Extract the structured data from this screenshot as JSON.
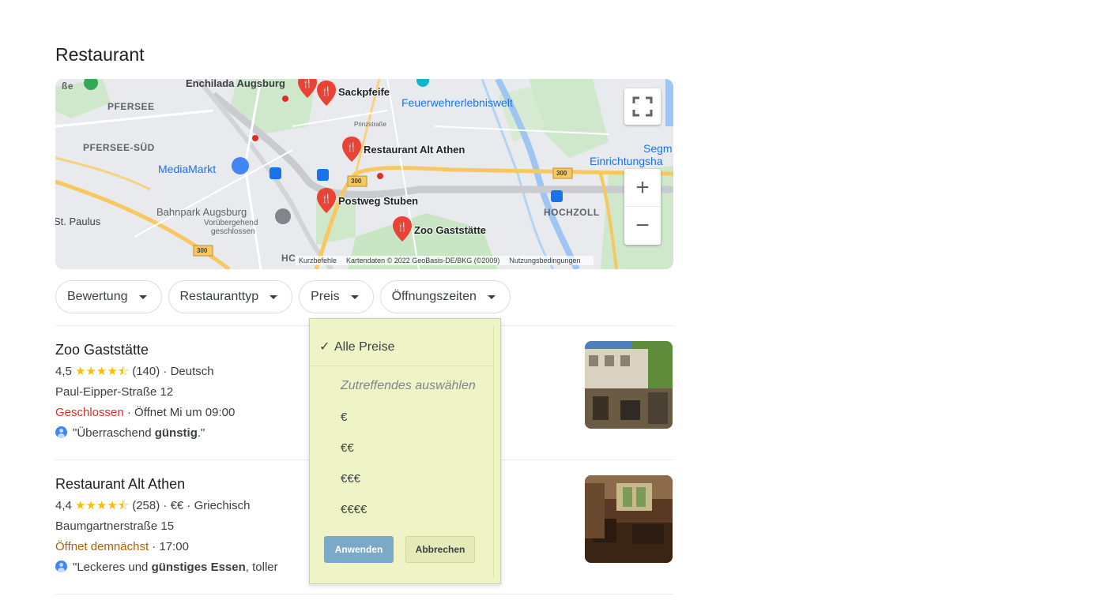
{
  "section": {
    "title": "Restaurant"
  },
  "map": {
    "labels": {
      "enchilada": "Enchilada Augsburg",
      "sackpfeife": "Sackpfeife",
      "feuerwehr": "Feuerwehrerlebniswelt",
      "pfersee": "PFERSEE",
      "pfersee_sued": "PFERSEE-SÜD",
      "mediamarkt": "MediaMarkt",
      "alt_athen": "Restaurant Alt Athen",
      "postweg": "Postweg Stuben",
      "zoo": "Zoo Gaststätte",
      "bahnpark": "Bahnpark Augsburg",
      "bahnpark_sub1": "Vorübergehend",
      "bahnpark_sub2": "geschlossen",
      "st_paulus": "St. Paulus",
      "hochzoll": "HOCHZOLL",
      "segm": "Segm",
      "einrichtung": "Einrichtungsha",
      "hc": "HC",
      "prinzstrasse": "Prinzstraße",
      "road_300_a": "300",
      "road_300_b": "300",
      "road_300_c": "300"
    },
    "attribution": {
      "shortcuts": "Kurzbefehle",
      "data": "Kartendaten © 2022 GeoBasis-DE/BKG (©2009)",
      "terms": "Nutzungsbedingungen"
    },
    "controls": {
      "zoom_in": "+",
      "zoom_out": "−"
    },
    "colors": {
      "park": "#c8e6c4",
      "water": "#9fc6f2",
      "highway": "#f6c85f",
      "pin": "#ea4335"
    }
  },
  "filters": [
    {
      "label": "Bewertung"
    },
    {
      "label": "Restauranttyp"
    },
    {
      "label": "Preis"
    },
    {
      "label": "Öffnungszeiten"
    }
  ],
  "results": [
    {
      "name": "Zoo Gaststätte",
      "rating": "4,5",
      "stars": "★★★★⯪",
      "reviews": "(140)",
      "meta": " · Deutsch",
      "address": "Paul-Eipper-Straße 12",
      "status": "Geschlossen",
      "hours": " · Öffnet Mi um 09:00",
      "review_pre": "\"Überraschend ",
      "review_bold": "günstig",
      "review_post": ".\""
    },
    {
      "name": "Restaurant Alt Athen",
      "rating": "4,4",
      "stars": "★★★★⯪",
      "reviews": "(258)",
      "meta": " · €€ · Griechisch",
      "address": "Baumgartnerstraße 15",
      "status": "Öffnet demnächst",
      "hours": " · 17:00",
      "review_pre": "\"Leckeres und ",
      "review_bold": "günstiges Essen",
      "review_post": ", toller"
    }
  ],
  "price_dropdown": {
    "selected": "Alle Preise",
    "check": "✓",
    "hint": "Zutreffendes auswählen",
    "options": [
      "€",
      "€€",
      "€€€",
      "€€€€"
    ],
    "apply": "Anwenden",
    "cancel": "Abbrechen",
    "colors": {
      "background": "#eef4c6",
      "apply": "#7baac9"
    }
  }
}
